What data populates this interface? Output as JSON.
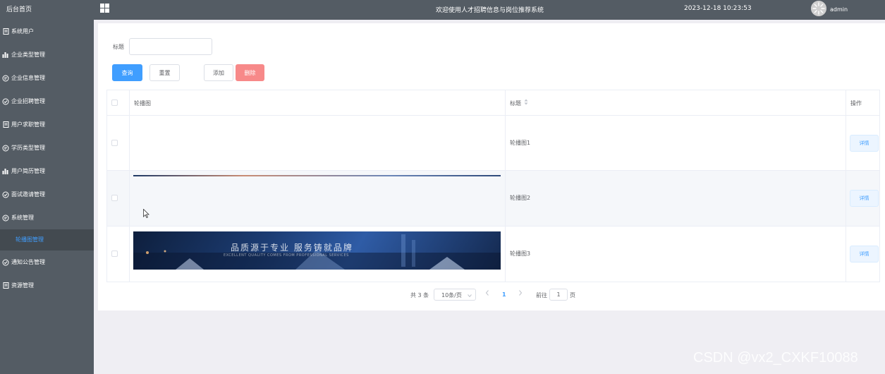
{
  "sidebar": {
    "home": "后台首页",
    "items": [
      {
        "label": "系统用户",
        "icon": "document-icon"
      },
      {
        "label": "企业类型管理",
        "icon": "bar-chart-icon"
      },
      {
        "label": "企业信息管理",
        "icon": "chat-icon"
      },
      {
        "label": "企业招聘管理",
        "icon": "check-circle-icon"
      },
      {
        "label": "用户求职管理",
        "icon": "document-icon"
      },
      {
        "label": "学历类型管理",
        "icon": "chat-icon"
      },
      {
        "label": "用户简历管理",
        "icon": "bar-chart-icon"
      },
      {
        "label": "面试邀请管理",
        "icon": "check-circle-icon"
      },
      {
        "label": "系统管理",
        "icon": "chat-icon"
      }
    ],
    "sub_item": "轮播图管理",
    "after_items": [
      {
        "label": "通知公告管理",
        "icon": "check-circle-icon"
      },
      {
        "label": "资源管理",
        "icon": "document-icon"
      }
    ]
  },
  "header": {
    "welcome": "欢迎使用人才招聘信息与岗位推荐系统",
    "datetime": "2023-12-18 10:23:53",
    "username": "admin"
  },
  "search": {
    "title_label": "标题",
    "title_value": ""
  },
  "buttons": {
    "query": "查询",
    "reset": "重置",
    "add": "添加",
    "delete": "删除"
  },
  "table": {
    "headers": {
      "image": "轮播图",
      "title": "标题",
      "actions": "操作"
    },
    "rows": [
      {
        "title": "轮播图1",
        "action": "详情"
      },
      {
        "title": "轮播图2",
        "action": "详情"
      },
      {
        "title": "轮播图3",
        "action": "详情"
      }
    ],
    "banner_text": "品质源于专业 服务铸就品牌",
    "banner_sub": "EXCELLENT QUALITY COMES FROM PROFESSIONAL SERVICES"
  },
  "pagination": {
    "total": "共 3 条",
    "page_size": "10条/页",
    "current_page": "1",
    "goto_label": "前往",
    "goto_value": "1",
    "page_unit": "页"
  },
  "watermark": "CSDN @vx2_CXKF10088",
  "colors": {
    "sidebar": "#545c64",
    "primary": "#409eff",
    "danger": "#f78989",
    "active": "#434a50"
  }
}
